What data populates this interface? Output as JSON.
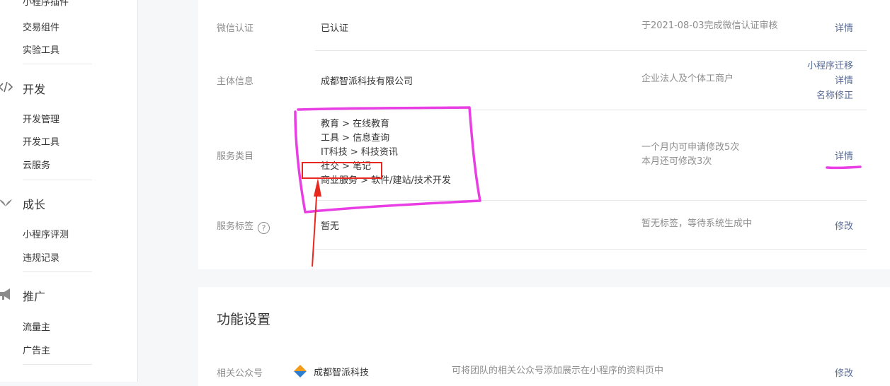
{
  "sidebar": {
    "cut_item": "小程序插件",
    "items_top": [
      "交易组件",
      "实验工具"
    ],
    "groups": [
      {
        "icon": "code-icon",
        "label": "开发",
        "items": [
          "开发管理",
          "开发工具",
          "云服务"
        ]
      },
      {
        "icon": "sprout-icon",
        "label": "成长",
        "items": [
          "小程序评测",
          "违规记录"
        ]
      },
      {
        "icon": "megaphone-icon",
        "label": "推广",
        "items": [
          "流量主",
          "广告主"
        ]
      }
    ]
  },
  "info": {
    "wechat_auth": {
      "label": "微信认证",
      "value": "已认证",
      "desc": "于2021-08-03完成微信认证审核",
      "action": "详情"
    },
    "entity": {
      "label": "主体信息",
      "value": "成都智派科技有限公司",
      "desc": "企业法人及个体工商户",
      "actions": [
        "小程序迁移",
        "详情",
        "名称修正"
      ]
    },
    "category": {
      "label": "服务类目",
      "values": [
        "教育 > 在线教育",
        "工具 > 信息查询",
        "IT科技 > 科技资讯",
        "社交 > 笔记",
        "商业服务 > 软件/建站/技术开发"
      ],
      "desc": [
        "一个月内可申请修改5次",
        "本月还可修改3次"
      ],
      "action": "详情"
    },
    "tags": {
      "label": "服务标签",
      "help_icon": "question-circle-icon",
      "help_glyph": "?",
      "value": "暂无",
      "desc": "暂无标签，等待系统生成中",
      "action": "修改"
    }
  },
  "functions": {
    "title": "功能设置",
    "related_account": {
      "label": "相关公众号",
      "icon": "diamond-logo-icon",
      "name": "成都智派科技",
      "desc": "可将团队的相关公众号添加展示在小程序的资料页中",
      "action": "修改"
    }
  },
  "colors": {
    "link": "#576b95",
    "annotation_magenta": "#e83ee3",
    "annotation_red": "#e8281e"
  }
}
